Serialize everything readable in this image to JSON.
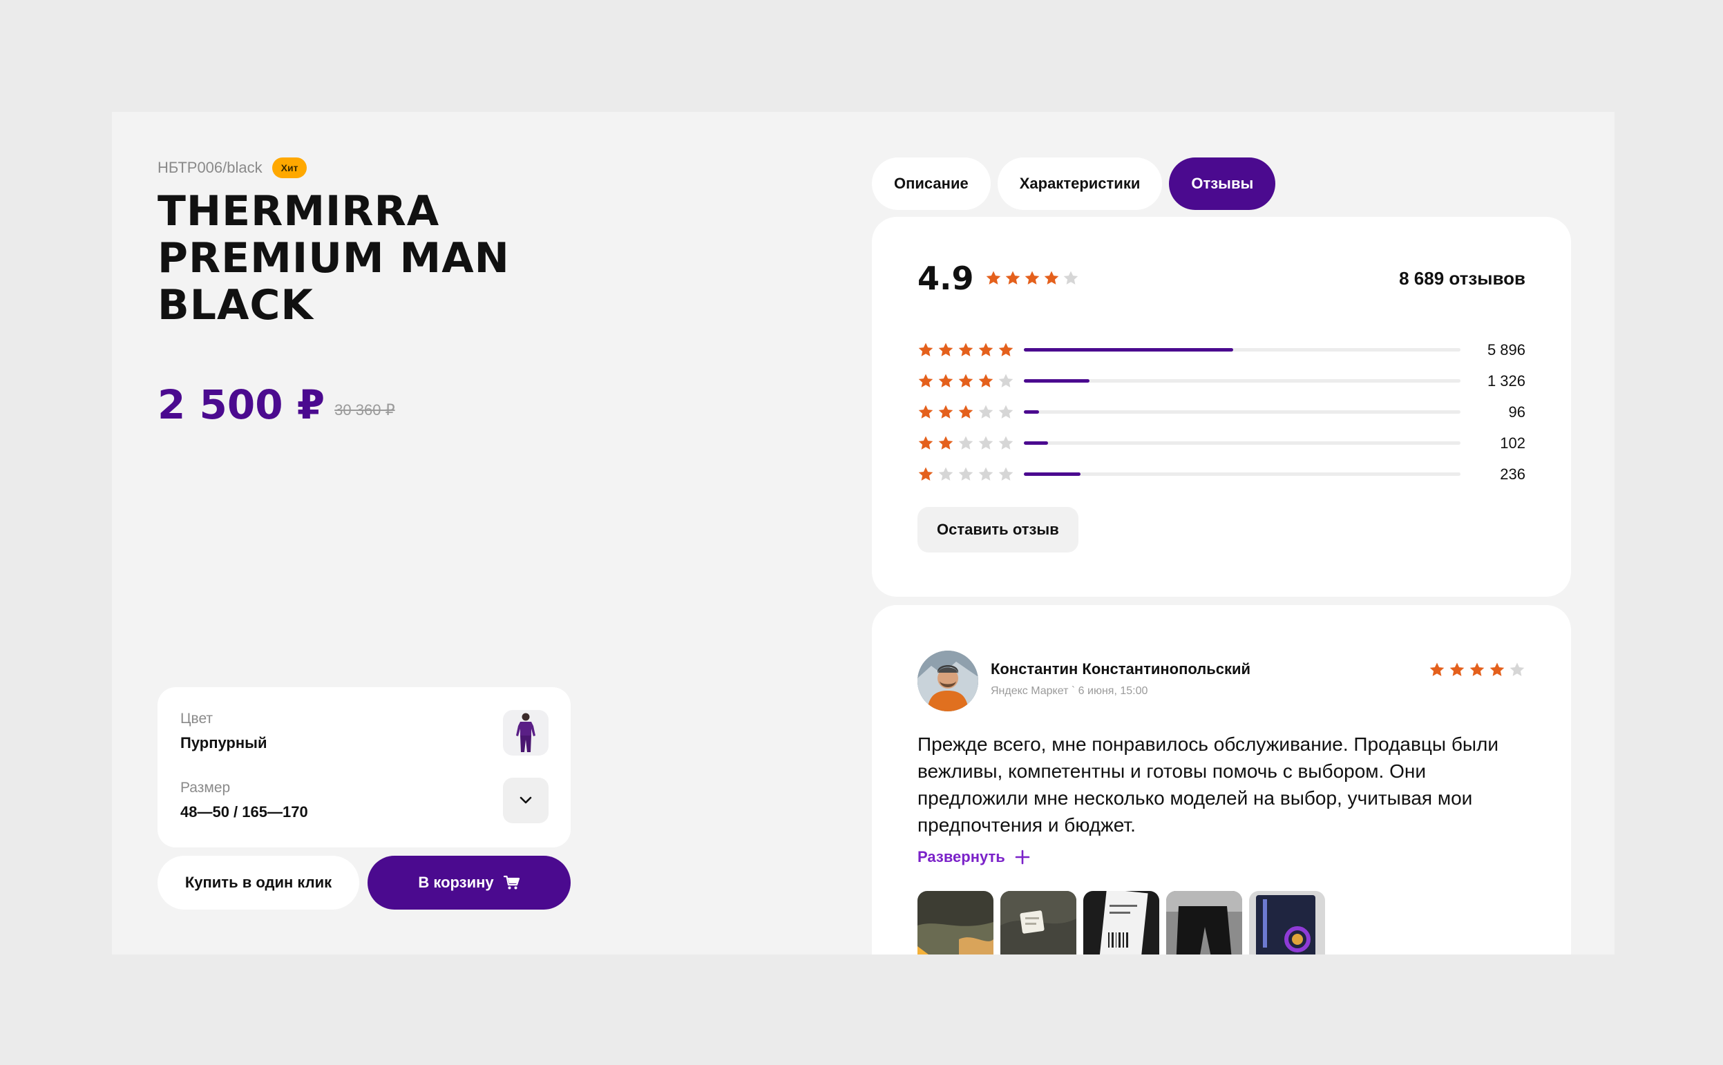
{
  "product": {
    "sku": "НБТР006/black",
    "badge": "Хит",
    "title": "THERMIRRA PREMIUM MAN BLACK",
    "price": "2 500 ₽",
    "old_price": "30 360 ₽"
  },
  "options": {
    "color_label": "Цвет",
    "color_value": "Пурпурный",
    "size_label": "Размер",
    "size_value": "48—50 / 165—170"
  },
  "actions": {
    "buy_one_click": "Купить в один клик",
    "add_to_cart": "В корзину"
  },
  "tabs": [
    {
      "label": "Описание",
      "active": false
    },
    {
      "label": "Характеристики",
      "active": false
    },
    {
      "label": "Отзывы",
      "active": true
    }
  ],
  "summary": {
    "rating": "4.9",
    "rating_stars": 4,
    "total": "8 689 отзывов",
    "distribution": [
      {
        "stars": 5,
        "count": "5 896",
        "fraction": 0.48
      },
      {
        "stars": 4,
        "count": "1 326",
        "fraction": 0.15
      },
      {
        "stars": 3,
        "count": "96",
        "fraction": 0.035
      },
      {
        "stars": 2,
        "count": "102",
        "fraction": 0.055
      },
      {
        "stars": 1,
        "count": "236",
        "fraction": 0.13
      }
    ],
    "leave_review": "Оставить отзыв"
  },
  "review": {
    "author": "Константин Константинопольский",
    "source": "Яндекс Маркет",
    "date": "6 июня, 15:00",
    "stars": 4,
    "text": "Прежде всего, мне понравилось обслуживание. Продавцы были вежливы, компетентны и готовы помочь с выбором. Они предложили мне несколько моделей на выбор, учитывая мои предпочтения и бюджет.",
    "expand_label": "Развернуть",
    "photos": 5
  },
  "colors": {
    "accent": "#4b0a8f",
    "star": "#e4601c",
    "star_empty": "#d6d6d6",
    "badge": "#ffa800",
    "link": "#7b22c9"
  }
}
